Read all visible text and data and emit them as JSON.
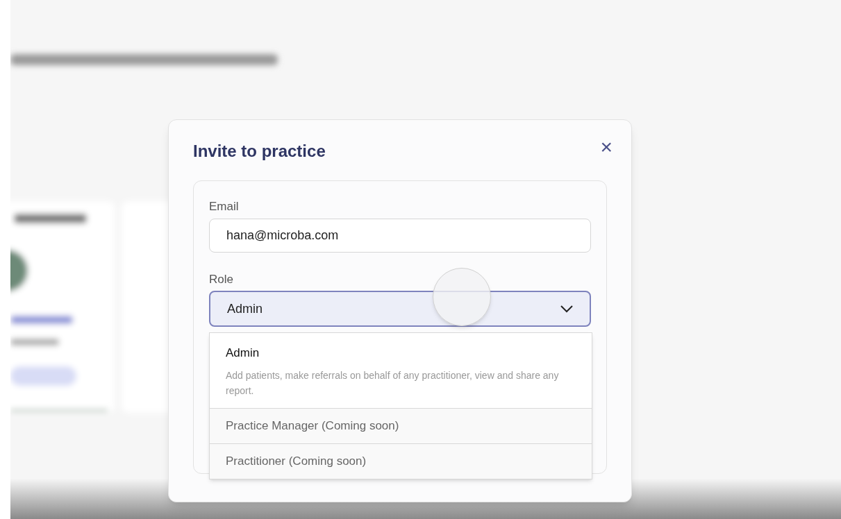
{
  "dialog": {
    "title": "Invite to practice",
    "close": "×"
  },
  "email": {
    "label": "Email",
    "value": "hana@microba.com"
  },
  "role": {
    "label": "Role",
    "value": "Admin",
    "expanded": true,
    "options": [
      {
        "label": "Admin",
        "description": "Add patients, make referrals on behalf of any practitioner, view and share any report.",
        "selected": true,
        "disabled": false
      },
      {
        "label": "Practice Manager (Coming soon)",
        "selected": false,
        "disabled": true
      },
      {
        "label": "Practitioner (Coming soon)",
        "selected": false,
        "disabled": true
      }
    ]
  }
}
